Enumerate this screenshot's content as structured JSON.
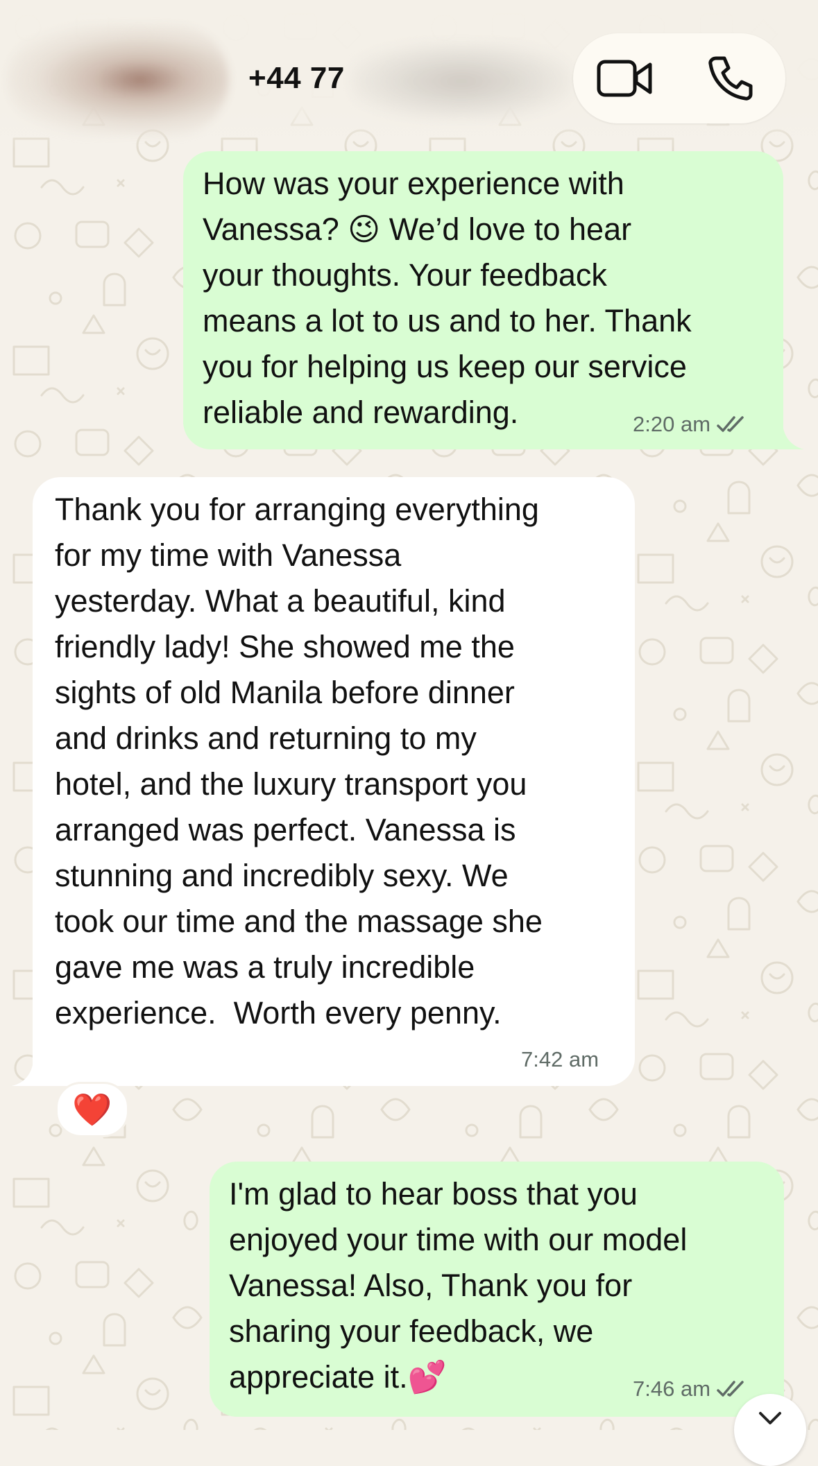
{
  "header": {
    "contact_name": "+44 77"
  },
  "icons": {
    "video_call": "video-camera-icon",
    "voice_call": "phone-icon",
    "scroll_down": "chevron-down-icon"
  },
  "colors": {
    "outgoing_bubble": "#d9fdd3",
    "incoming_bubble": "#ffffff",
    "wallpaper": "#f5f1ea"
  },
  "messages": [
    {
      "direction": "outgoing",
      "lines": [
        "How was your experience with",
        "Vanessa? 😉 We’d love to hear",
        "your thoughts. Your feedback",
        "means a lot to us and to her. Thank",
        "you for helping us keep our service",
        "reliable and rewarding."
      ],
      "time": "2:20 am",
      "status": "read"
    },
    {
      "direction": "incoming",
      "lines": [
        "Thank you for arranging everything",
        "for my time with Vanessa",
        "yesterday. What a beautiful, kind",
        "friendly lady! She showed me the",
        "sights of old Manila before dinner",
        "and drinks and returning to my",
        "hotel, and the luxury transport you",
        "arranged was perfect. Vanessa is",
        "stunning and incredibly sexy. We",
        "took our time and the massage she",
        "gave me was a truly incredible",
        "experience.  Worth every penny."
      ],
      "time": "7:42 am",
      "reaction": "❤️"
    },
    {
      "direction": "outgoing",
      "lines": [
        "I'm glad to hear boss that you",
        "enjoyed your time with our model",
        "Vanessa! Also, Thank you for",
        "sharing your feedback, we",
        "appreciate it.💕"
      ],
      "time": "7:46 am",
      "status": "read"
    }
  ]
}
